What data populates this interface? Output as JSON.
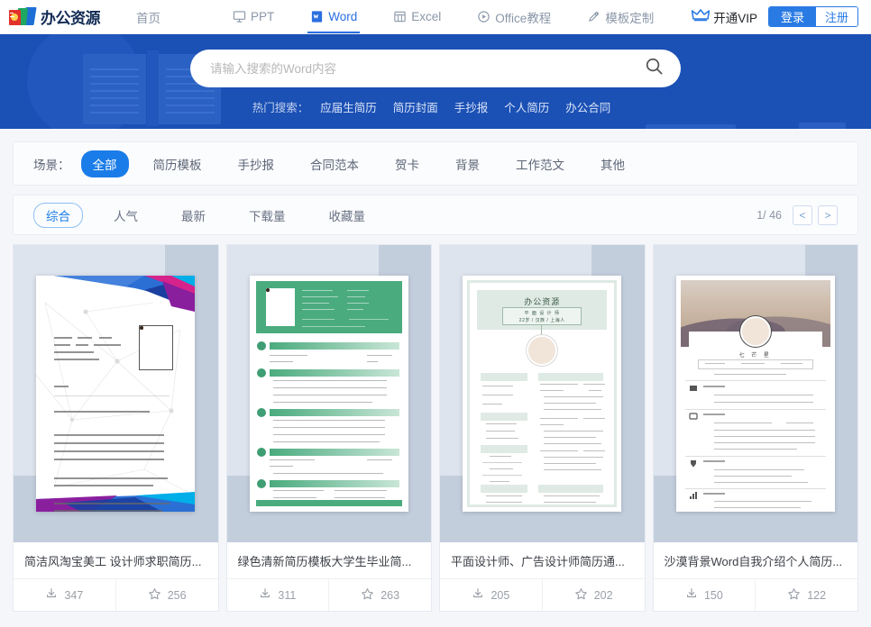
{
  "site": {
    "logo_text": "办公资源",
    "logo_icon": "books-logo-icon"
  },
  "nav": {
    "items": [
      {
        "label": "首页",
        "icon": "",
        "active": false
      },
      {
        "label": "PPT",
        "icon": "ppt-screen-icon",
        "active": false
      },
      {
        "label": "Word",
        "icon": "word-document-icon",
        "active": true
      },
      {
        "label": "Excel",
        "icon": "excel-table-icon",
        "active": false
      },
      {
        "label": "Office教程",
        "icon": "play-circle-icon",
        "active": false
      },
      {
        "label": "模板定制",
        "icon": "pencil-icon",
        "active": false
      }
    ],
    "vip_label": "开通VIP",
    "vip_icon": "crown-icon",
    "login_label": "登录",
    "register_label": "注册",
    "accent_color": "#2a7ae4",
    "active_color": "#2a6fe0"
  },
  "banner": {
    "background_color": "#1b50b5",
    "search": {
      "placeholder": "请输入搜索的Word内容",
      "value": "",
      "icon": "search-icon"
    },
    "hot": {
      "label": "热门搜索：",
      "tags": [
        "应届生简历",
        "简历封面",
        "手抄报",
        "个人简历",
        "办公合同"
      ]
    }
  },
  "filters": {
    "scene_label": "场景：",
    "scenes": [
      {
        "label": "全部",
        "active": true
      },
      {
        "label": "简历模板",
        "active": false
      },
      {
        "label": "手抄报",
        "active": false
      },
      {
        "label": "合同范本",
        "active": false
      },
      {
        "label": "贺卡",
        "active": false
      },
      {
        "label": "背景",
        "active": false
      },
      {
        "label": "工作范文",
        "active": false
      },
      {
        "label": "其他",
        "active": false
      }
    ],
    "sorts": [
      {
        "label": "综合",
        "active": true
      },
      {
        "label": "人气",
        "active": false
      },
      {
        "label": "最新",
        "active": false
      },
      {
        "label": "下载量",
        "active": false
      },
      {
        "label": "收藏量",
        "active": false
      }
    ],
    "pagination": {
      "text": "1/ 46",
      "prev": "<",
      "next": ">"
    }
  },
  "results": {
    "cards": [
      {
        "title": "简洁风淘宝美工 设计师求职简历...",
        "downloads": "347",
        "favorites": "256",
        "download_icon": "download-icon",
        "favorite_icon": "star-icon"
      },
      {
        "title": "绿色清新简历模板大学生毕业简...",
        "downloads": "311",
        "favorites": "263",
        "download_icon": "download-icon",
        "favorite_icon": "star-icon"
      },
      {
        "title": "平面设计师、广告设计师简历通...",
        "downloads": "205",
        "favorites": "202",
        "download_icon": "download-icon",
        "favorite_icon": "star-icon"
      },
      {
        "title": "沙漠背景Word自我介绍个人简历...",
        "downloads": "150",
        "favorites": "122",
        "download_icon": "download-icon",
        "favorite_icon": "star-icon"
      }
    ],
    "thumb3_heading": "办公资源",
    "thumb3_sub1": "平 面 设 计 师",
    "thumb3_sub2": "22岁 / 汉族 / 上海人",
    "thumb4_name": "七 芒 星"
  }
}
